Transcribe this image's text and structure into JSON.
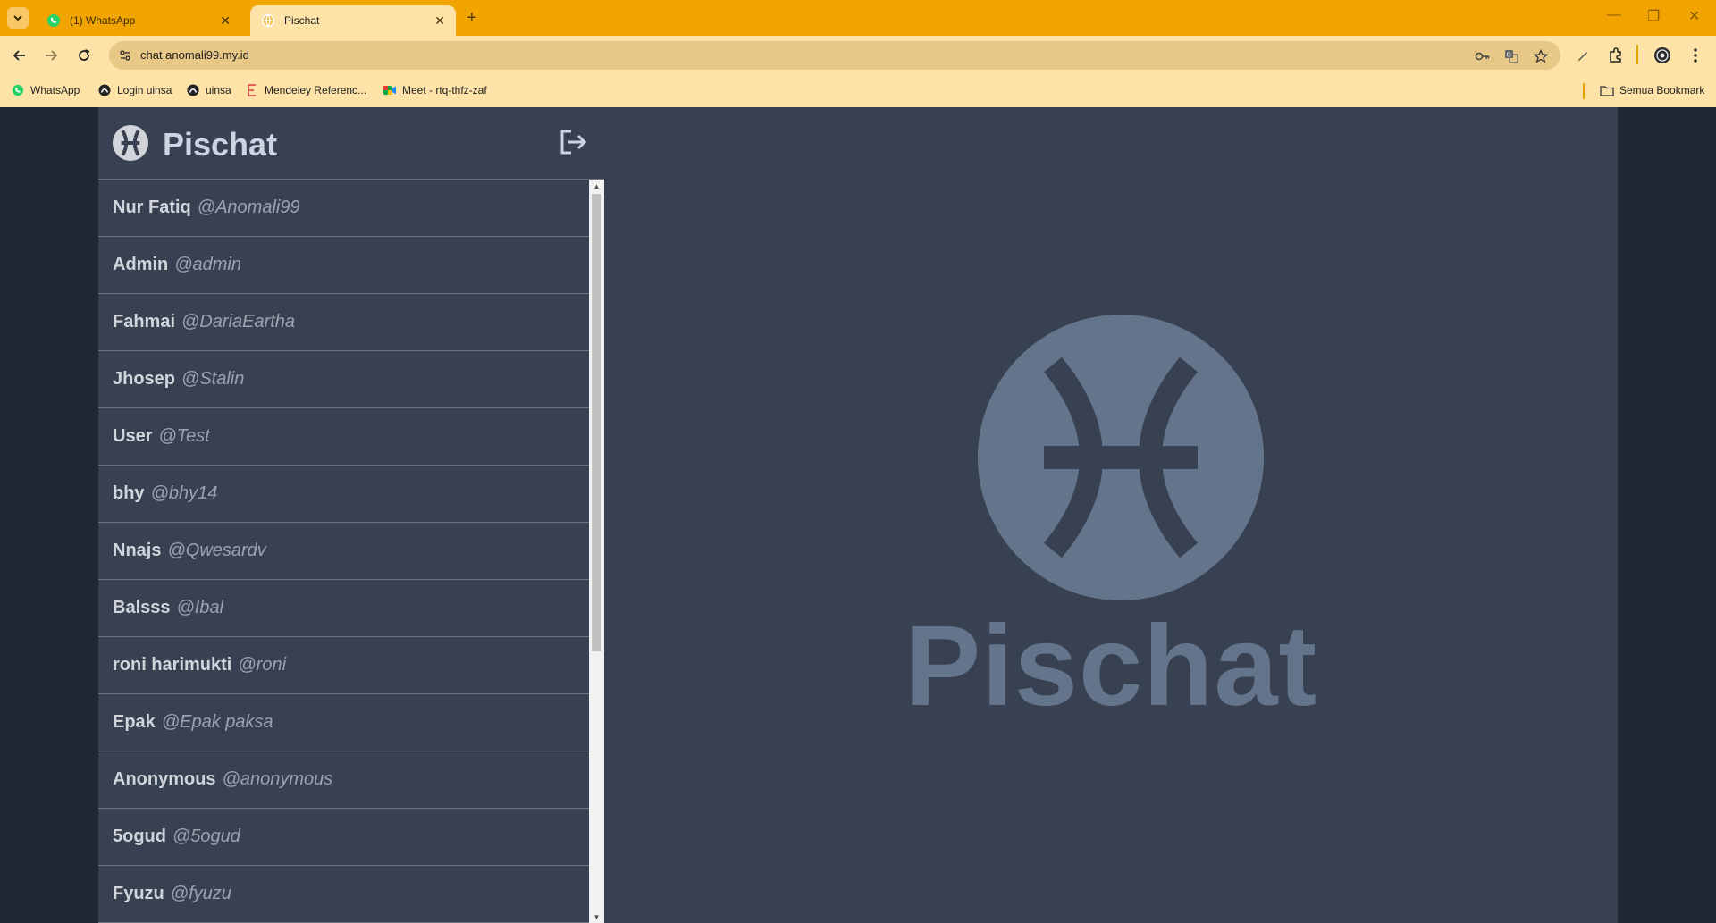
{
  "browser": {
    "tabs": [
      {
        "title": "(1) WhatsApp",
        "icon": "whatsapp-icon"
      },
      {
        "title": "Pischat",
        "icon": "globe-icon"
      }
    ],
    "url": "chat.anomali99.my.id",
    "bookmarks": [
      {
        "label": "WhatsApp",
        "icon": "whatsapp-icon"
      },
      {
        "label": "Login uinsa",
        "icon": "moodle-icon"
      },
      {
        "label": "uinsa",
        "icon": "moodle-icon"
      },
      {
        "label": "Mendeley Referenc...",
        "icon": "mendeley-icon"
      },
      {
        "label": "Meet - rtq-thfz-zaf",
        "icon": "meet-icon"
      }
    ],
    "all_bookmarks": "Semua Bookmark",
    "colors": {
      "frame": "#f2a401",
      "toolbar": "#fde3a8"
    }
  },
  "app": {
    "brand": "Pischat",
    "hero_title": "Pischat",
    "users": [
      {
        "name": "Nur Fatiq",
        "handle": "@Anomali99"
      },
      {
        "name": "Admin",
        "handle": "@admin"
      },
      {
        "name": "Fahmai",
        "handle": "@DariaEartha"
      },
      {
        "name": "Jhosep",
        "handle": "@Stalin"
      },
      {
        "name": "User",
        "handle": "@Test"
      },
      {
        "name": "bhy",
        "handle": "@bhy14"
      },
      {
        "name": "Nnajs",
        "handle": "@Qwesardv"
      },
      {
        "name": "Balsss",
        "handle": "@Ibal"
      },
      {
        "name": "roni harimukti",
        "handle": "@roni"
      },
      {
        "name": "Epak",
        "handle": "@Epak paksa"
      },
      {
        "name": "Anonymous",
        "handle": "@anonymous"
      },
      {
        "name": "5ogud",
        "handle": "@5ogud"
      },
      {
        "name": "Fyuzu",
        "handle": "@fyuzu"
      }
    ],
    "colors": {
      "panel": "#374151",
      "logo": "#64748b",
      "page_bg": "#1f2733"
    }
  }
}
